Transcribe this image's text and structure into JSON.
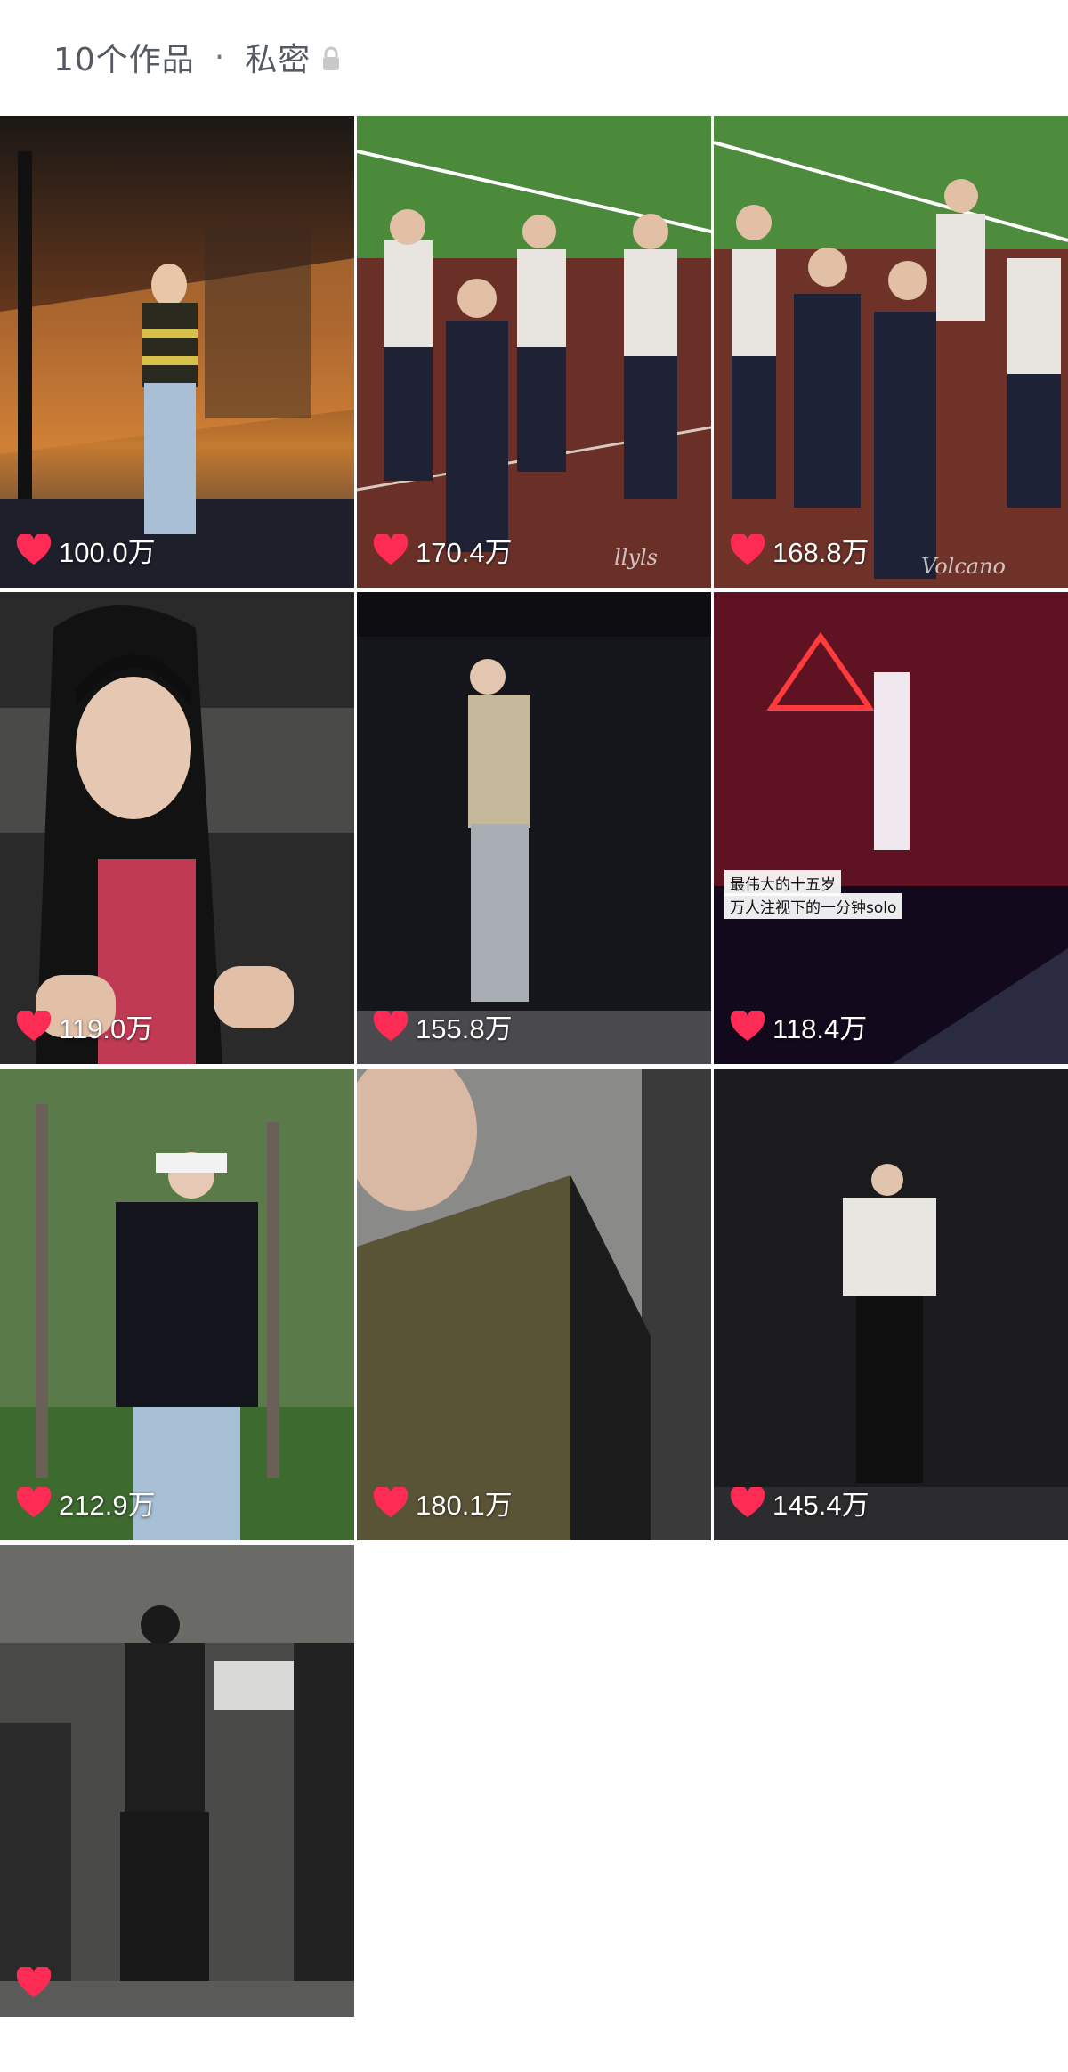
{
  "header": {
    "works_count": "10个作品",
    "separator": "·",
    "privacy": "私密"
  },
  "videos": [
    {
      "likes": "100.0万"
    },
    {
      "likes": "170.4万",
      "watermark": "llyls"
    },
    {
      "likes": "168.8万",
      "watermark": "Volcano"
    },
    {
      "likes": "119.0万"
    },
    {
      "likes": "155.8万"
    },
    {
      "likes": "118.4万",
      "caption_1": "最伟大的十五岁",
      "caption_2": "万人注视下的一分钟solo"
    },
    {
      "likes": "212.9万"
    },
    {
      "likes": "180.1万"
    },
    {
      "likes": "145.4万"
    },
    {
      "likes": ""
    }
  ],
  "colors": {
    "heart": "#fe2c55",
    "header_text": "#555a61",
    "lock": "#c8c8c8"
  }
}
